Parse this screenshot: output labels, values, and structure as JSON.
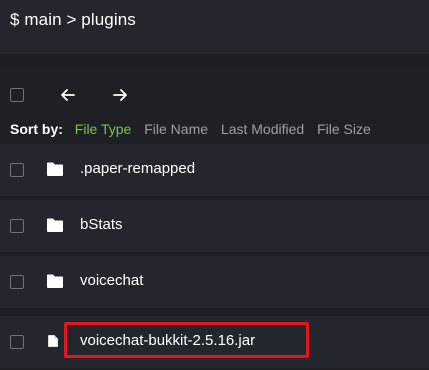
{
  "breadcrumb": {
    "text": "$ main > plugins"
  },
  "toolbar": {
    "back_icon": "arrow-left-icon",
    "forward_icon": "arrow-right-icon"
  },
  "sort": {
    "label": "Sort by:",
    "options": [
      {
        "label": "File Type",
        "active": true
      },
      {
        "label": "File Name",
        "active": false
      },
      {
        "label": "Last Modified",
        "active": false
      },
      {
        "label": "File Size",
        "active": false
      }
    ]
  },
  "files": [
    {
      "name": ".paper-remapped",
      "type": "folder",
      "icon": "folder-icon"
    },
    {
      "name": "bStats",
      "type": "folder",
      "icon": "folder-icon"
    },
    {
      "name": "voicechat",
      "type": "folder",
      "icon": "folder-icon"
    },
    {
      "name": "voicechat-bukkit-2.5.16.jar",
      "type": "file",
      "icon": "file-icon",
      "highlighted": true
    }
  ],
  "colors": {
    "background": "#1b1f24",
    "row": "#23272d",
    "accent": "#7cc34a",
    "highlight": "#e6141b"
  }
}
